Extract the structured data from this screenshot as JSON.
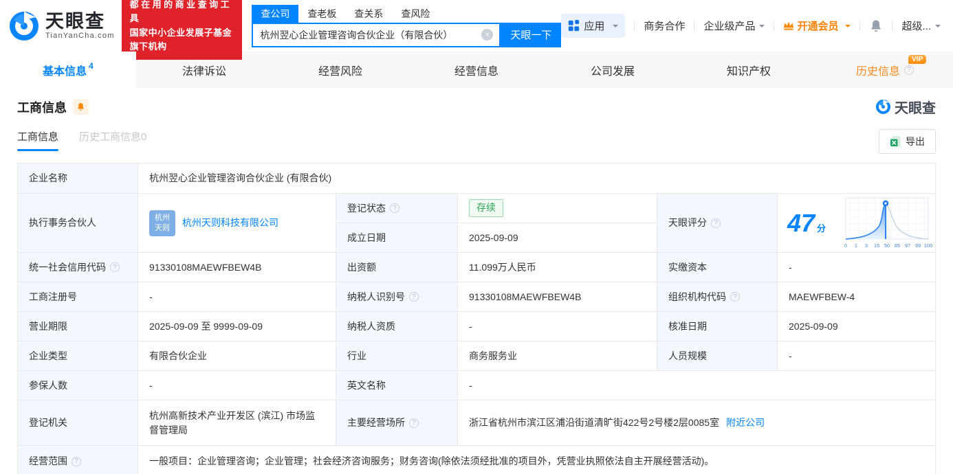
{
  "colors": {
    "brand_blue": "#0084ff",
    "banner_red": "#e0222a",
    "vip_orange": "#ff8a00",
    "status_green": "#2fa455"
  },
  "icons": {
    "help": "?",
    "clear": "×"
  },
  "header": {
    "logo": {
      "brand": "天眼查",
      "domain": "TianYanCha.com"
    },
    "banner": {
      "line1": "都在用的商业查询工具",
      "line2": "国家中小企业发展子基金旗下机构"
    },
    "search": {
      "tabs": [
        "查公司",
        "查老板",
        "查关系",
        "查风险"
      ],
      "active_tab": "查公司",
      "value": "杭州翌心企业管理咨询合伙企业（有限合伙）",
      "button": "天眼一下"
    },
    "nav": {
      "apps": "应用",
      "cooperation": "商务合作",
      "enterprise": "企业级产品",
      "vip": "开通会员",
      "user": "超级..."
    }
  },
  "tabs": {
    "items": [
      {
        "label": "基本信息",
        "count": "4",
        "active": true
      },
      {
        "label": "法律诉讼"
      },
      {
        "label": "经营风险"
      },
      {
        "label": "经营信息"
      },
      {
        "label": "公司发展"
      },
      {
        "label": "知识产权"
      },
      {
        "label": "历史信息",
        "vip_tag": "VIP"
      }
    ]
  },
  "section": {
    "title": "工商信息",
    "watermark": "天眼查",
    "subtab_active": "工商信息",
    "subtab_history": "历史工商信息0",
    "export_label": "导出"
  },
  "fields": {
    "company_name": {
      "label": "企业名称",
      "value": "杭州翌心企业管理咨询合伙企业 (有限合伙)"
    },
    "executive_partner": {
      "label": "执行事务合伙人",
      "value": "杭州天则科技有限公司",
      "avatar_line1": "杭州",
      "avatar_line2": "天则"
    },
    "reg_status": {
      "label": "登记状态",
      "value": "存续"
    },
    "establish_date": {
      "label": "成立日期",
      "value": "2025-09-09"
    },
    "tyc_score": {
      "label": "天眼评分"
    },
    "credit_code": {
      "label": "统一社会信用代码",
      "value": "91330108MAEWFBEW4B"
    },
    "capital": {
      "label": "出资额",
      "value": "11.099万人民币"
    },
    "paid_capital": {
      "label": "实缴资本",
      "value": "-"
    },
    "reg_number": {
      "label": "工商注册号",
      "value": "-"
    },
    "taxpayer_id": {
      "label": "纳税人识别号",
      "value": "91330108MAEWFBEW4B"
    },
    "org_code": {
      "label": "组织机构代码",
      "value": "MAEWFBEW-4"
    },
    "business_term": {
      "label": "营业期限",
      "value": "2025-09-09 至 9999-09-09"
    },
    "taxpayer_quality": {
      "label": "纳税人资质",
      "value": "-"
    },
    "approval_date": {
      "label": "核准日期",
      "value": "2025-09-09"
    },
    "company_type": {
      "label": "企业类型",
      "value": "有限合伙企业"
    },
    "industry": {
      "label": "行业",
      "value": "商务服务业"
    },
    "staff_size": {
      "label": "人员规模",
      "value": "-"
    },
    "insured_count": {
      "label": "参保人数",
      "value": "-"
    },
    "english_name": {
      "label": "英文名称",
      "value": "-"
    },
    "reg_authority": {
      "label": "登记机关",
      "value": "杭州高新技术产业开发区 (滨江) 市场监督管理局"
    },
    "business_address": {
      "label": "主要经营场所",
      "value": "浙江省杭州市滨江区浦沿街道清旷街422号2号楼2层0085室",
      "link": "附近公司"
    },
    "business_scope": {
      "label": "经营范围",
      "value": "一般项目：企业管理咨询；企业管理；社会经济咨询服务；财务咨询(除依法须经批准的项目外，凭营业执照依法自主开展经营活动)。"
    }
  },
  "chart_data": {
    "type": "line",
    "title": "天眼评分",
    "score": "47",
    "unit": "分",
    "axis_labels": [
      "0",
      "1",
      "3",
      "15",
      "50",
      "85",
      "97",
      "99",
      "100"
    ],
    "marker_at_label": "50",
    "note": "bell-curve distribution, area left of score filled blue"
  }
}
